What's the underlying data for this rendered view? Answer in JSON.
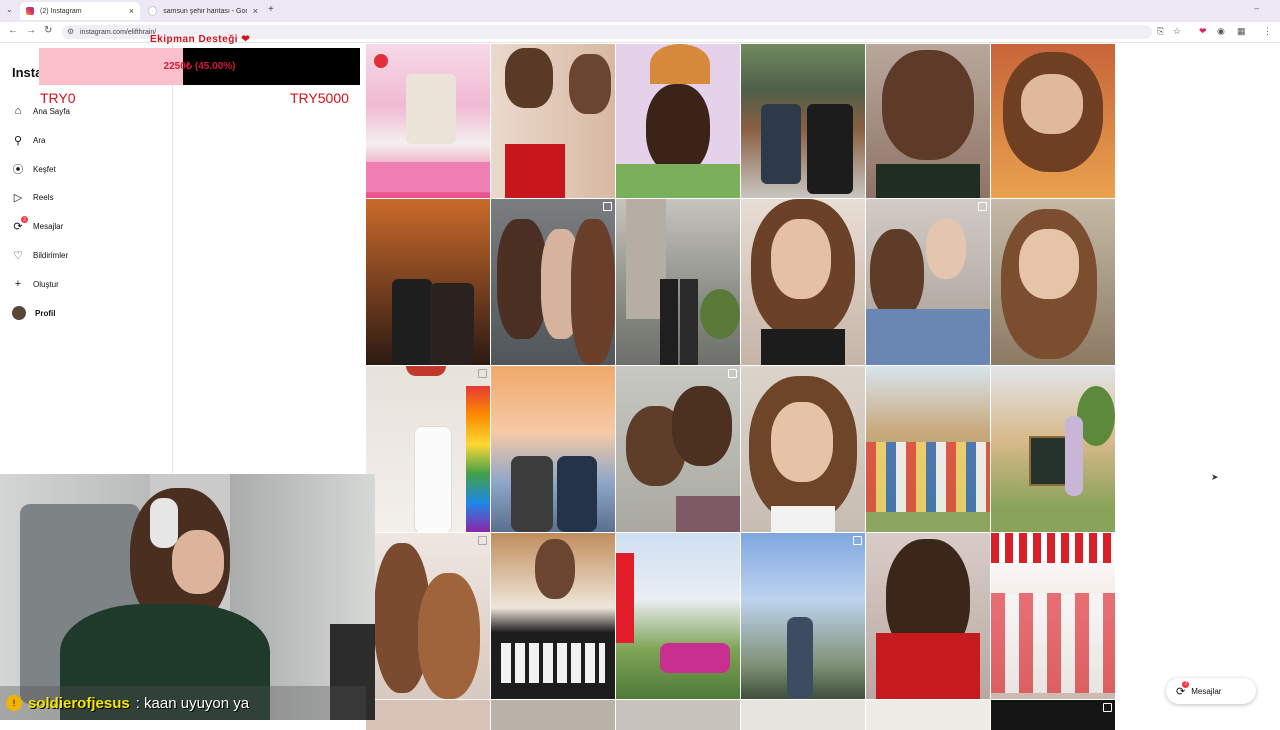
{
  "browser": {
    "tabs": [
      {
        "title": "(2) Instagram",
        "active": true
      },
      {
        "title": "samsun şehir haritası - Googl",
        "active": false
      }
    ],
    "url": "instagram.com/elifthrain/"
  },
  "donation": {
    "title": "Ekipman Desteği ❤",
    "progress_text": "2250₺ (45.00%)",
    "progress_fraction": 0.45,
    "min_label": "TRY0",
    "max_label": "TRY5000",
    "fill_color": "#f9c0cb",
    "accent_color": "#d5111b"
  },
  "sidebar": {
    "brand": "Insta",
    "items": [
      {
        "label": "Ana Sayfa",
        "icon": "home-icon"
      },
      {
        "label": "Ara",
        "icon": "search-icon"
      },
      {
        "label": "Keşfet",
        "icon": "compass-icon"
      },
      {
        "label": "Reels",
        "icon": "reels-icon"
      },
      {
        "label": "Mesajlar",
        "icon": "messenger-icon",
        "badge": "2"
      },
      {
        "label": "Bildirimler",
        "icon": "heart-icon"
      },
      {
        "label": "Oluştur",
        "icon": "plus-icon"
      },
      {
        "label": "Profil",
        "icon": "avatar-icon"
      }
    ]
  },
  "chat": {
    "username": "soldierofjesus",
    "message": ": kaan uyuyon ya"
  },
  "messages_button": {
    "label": "Mesajlar",
    "badge": "2"
  }
}
